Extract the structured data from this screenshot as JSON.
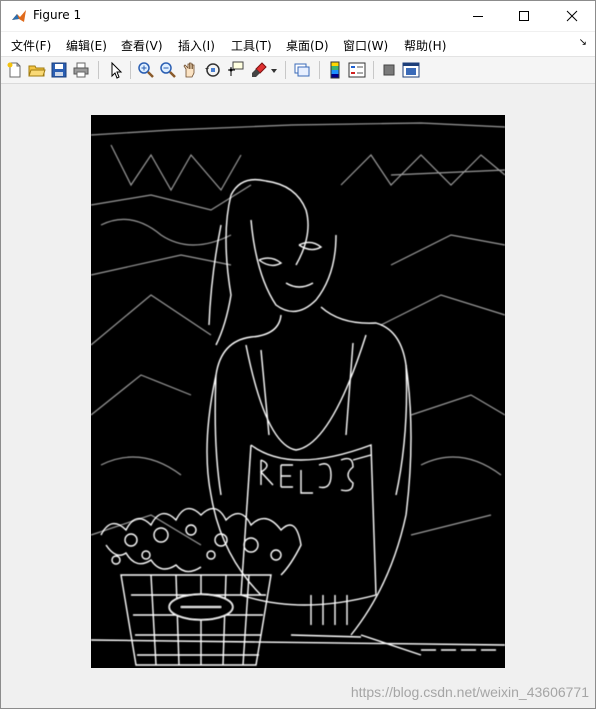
{
  "window": {
    "title": "Figure 1",
    "controls": {
      "minimize": "—",
      "maximize": "☐",
      "close": "✕"
    }
  },
  "menu": {
    "items": [
      {
        "label": "文件(F)"
      },
      {
        "label": "编辑(E)"
      },
      {
        "label": "查看(V)"
      },
      {
        "label": "插入(I)"
      },
      {
        "label": "工具(T)"
      },
      {
        "label": "桌面(D)"
      },
      {
        "label": "窗口(W)"
      },
      {
        "label": "帮助(H)"
      }
    ],
    "overflow": "↘"
  },
  "toolbar": {
    "icons": [
      "new-figure-icon",
      "open-file-icon",
      "save-icon",
      "print-icon",
      "edit-plot-arrow-icon",
      "zoom-in-icon",
      "zoom-out-icon",
      "pan-hand-icon",
      "rotate-3d-icon",
      "data-cursor-icon",
      "brush-icon",
      "brush-dropdown-icon",
      "link-plot-icon",
      "insert-colorbar-icon",
      "insert-legend-icon",
      "hide-plot-tools-icon",
      "show-plot-tools-icon"
    ]
  },
  "colors": {
    "accent_matlab": "#e06a1b",
    "panel_bg": "#f0f0f0",
    "image_bg": "#000000"
  },
  "figure": {
    "image_description_icon": "edge-detected-photo-image"
  },
  "watermark": "https://blog.csdn.net/weixin_43606771"
}
